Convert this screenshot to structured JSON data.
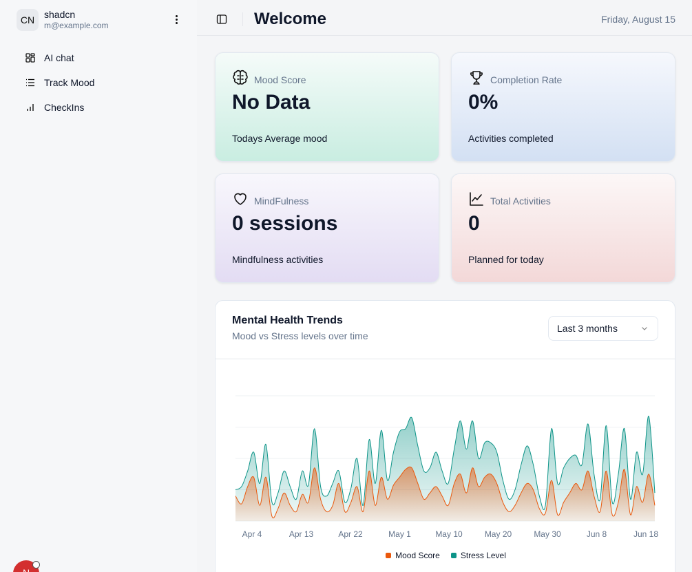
{
  "user": {
    "initials": "CN",
    "name": "shadcn",
    "email": "m@example.com"
  },
  "nav": [
    {
      "label": "AI chat",
      "icon": "layout-dashboard-icon"
    },
    {
      "label": "Track Mood",
      "icon": "list-icon"
    },
    {
      "label": "CheckIns",
      "icon": "bar-chart-icon"
    }
  ],
  "fab": {
    "label": "N"
  },
  "header": {
    "title": "Welcome",
    "date": "Friday, August 15"
  },
  "cards": {
    "mood": {
      "label": "Mood Score",
      "value": "No Data",
      "sub": "Todays Average mood",
      "icon": "brain-icon"
    },
    "completion": {
      "label": "Completion Rate",
      "value": "0%",
      "sub": "Activities completed",
      "icon": "trophy-icon"
    },
    "mindfulness": {
      "label": "MindFulness",
      "value": "0 sessions",
      "sub": "Mindfulness activities",
      "icon": "heart-icon"
    },
    "total": {
      "label": "Total Activities",
      "value": "0",
      "sub": "Planned for today",
      "icon": "line-chart-icon"
    }
  },
  "chart": {
    "title": "Mental Health Trends",
    "description": "Mood vs Stress levels over time",
    "range": "Last 3 months"
  },
  "colors": {
    "mood": "#ea580c",
    "stress": "#0d9488"
  },
  "chart_data": {
    "type": "area",
    "x_tick_labels": [
      "Apr 4",
      "Apr 13",
      "Apr 22",
      "May 1",
      "May 10",
      "May 20",
      "May 30",
      "Jun 8",
      "Jun 18"
    ],
    "xlabel": "",
    "ylabel": "",
    "ylim": [
      0,
      4
    ],
    "grid": "horizontal",
    "legend_position": "bottom",
    "series": [
      {
        "name": "Mood Score",
        "values": [
          0.8,
          0.55,
          1.1,
          1.4,
          0.5,
          1.4,
          0.15,
          0.4,
          0.9,
          0.5,
          0.3,
          0.85,
          0.6,
          1.7,
          0.7,
          0.3,
          0.5,
          1.2,
          0.3,
          0.6,
          1.1,
          0.3,
          1.6,
          0.5,
          1.4,
          0.7,
          1.15,
          1.4,
          1.65,
          1.7,
          1.2,
          0.7,
          0.9,
          1.1,
          0.8,
          0.5,
          1.2,
          1.5,
          0.9,
          1.7,
          1.1,
          1.4,
          1.5,
          1.2,
          0.6,
          0.3,
          0.5,
          0.9,
          1.2,
          1.0,
          0.4,
          0.25,
          1.3,
          0.2,
          0.6,
          0.9,
          1.2,
          1.0,
          1.6,
          0.8,
          0.3,
          1.6,
          0.2,
          0.6,
          1.65,
          0.2,
          1.1,
          0.6,
          1.5,
          0.5
        ]
      },
      {
        "name": "Stress Level",
        "values": [
          1.0,
          1.1,
          1.6,
          2.2,
          1.2,
          2.45,
          0.6,
          0.9,
          1.6,
          1.1,
          0.7,
          1.6,
          1.15,
          2.95,
          1.1,
          0.8,
          1.2,
          1.6,
          0.6,
          1.05,
          2.0,
          0.5,
          2.6,
          1.2,
          2.9,
          1.3,
          2.2,
          2.85,
          2.95,
          3.3,
          2.4,
          1.6,
          1.7,
          2.2,
          1.6,
          1.2,
          2.3,
          3.2,
          2.3,
          3.2,
          2.0,
          2.5,
          2.5,
          2.2,
          1.3,
          0.7,
          1.0,
          1.8,
          2.4,
          1.8,
          0.8,
          0.5,
          2.95,
          1.2,
          1.7,
          2.0,
          2.1,
          1.8,
          3.1,
          1.5,
          0.7,
          3.05,
          0.6,
          1.5,
          2.95,
          0.7,
          2.2,
          1.5,
          3.35,
          0.9
        ]
      }
    ]
  }
}
